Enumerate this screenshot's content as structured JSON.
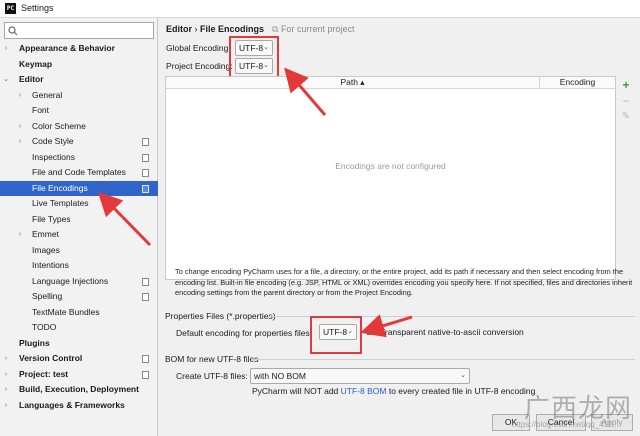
{
  "window": {
    "title": "Settings",
    "app_icon": "pycharm-icon"
  },
  "search": {
    "placeholder": "",
    "icon": "search-icon"
  },
  "sidebar": {
    "items": [
      {
        "label": "Appearance & Behavior",
        "bold": true,
        "expandable": true,
        "level": 0
      },
      {
        "label": "Keymap",
        "bold": true,
        "expandable": false,
        "level": 0
      },
      {
        "label": "Editor",
        "bold": true,
        "expandable": true,
        "expanded": true,
        "level": 0
      },
      {
        "label": "General",
        "expandable": true,
        "level": 1
      },
      {
        "label": "Font",
        "level": 1
      },
      {
        "label": "Color Scheme",
        "expandable": true,
        "level": 1
      },
      {
        "label": "Code Style",
        "expandable": true,
        "level": 1,
        "page_icon": true
      },
      {
        "label": "Inspections",
        "level": 1,
        "page_icon": true
      },
      {
        "label": "File and Code Templates",
        "level": 1,
        "page_icon": true
      },
      {
        "label": "File Encodings",
        "level": 1,
        "page_icon": true,
        "selected": true
      },
      {
        "label": "Live Templates",
        "level": 1
      },
      {
        "label": "File Types",
        "level": 1
      },
      {
        "label": "Emmet",
        "expandable": true,
        "level": 1
      },
      {
        "label": "Images",
        "level": 1
      },
      {
        "label": "Intentions",
        "level": 1
      },
      {
        "label": "Language Injections",
        "level": 1,
        "page_icon": true
      },
      {
        "label": "Spelling",
        "level": 1,
        "page_icon": true
      },
      {
        "label": "TextMate Bundles",
        "level": 1
      },
      {
        "label": "TODO",
        "level": 1
      },
      {
        "label": "Plugins",
        "bold": true,
        "level": 0
      },
      {
        "label": "Version Control",
        "bold": true,
        "expandable": true,
        "level": 0,
        "page_icon": true
      },
      {
        "label": "Project: test",
        "bold": true,
        "expandable": true,
        "level": 0,
        "page_icon": true
      },
      {
        "label": "Build, Execution, Deployment",
        "bold": true,
        "expandable": true,
        "level": 0
      },
      {
        "label": "Languages & Frameworks",
        "bold": true,
        "expandable": true,
        "level": 0
      }
    ]
  },
  "breadcrumb": {
    "section": "Editor",
    "separator": "›",
    "page": "File Encodings",
    "scope_note": "For current project"
  },
  "encoding": {
    "global_label": "Global Encoding:",
    "global_value": "UTF-8",
    "project_label": "Project Encoding:",
    "project_value": "UTF-8"
  },
  "table": {
    "columns": [
      "Path ▴",
      "Encoding"
    ],
    "empty_text": "Encodings are not configured",
    "tools": [
      "add-icon",
      "remove-icon",
      "edit-icon"
    ]
  },
  "description": "To change encoding PyCharm uses for a file, a directory, or the entire project, add its path if necessary and then select encoding from the encoding list. Built-in file encoding (e.g. JSP, HTML or XML) overrides encoding you specify here. If not specified, files and directories inherit encoding settings from the parent directory or from the Project Encoding.",
  "properties": {
    "section_title": "Properties Files (*.properties)",
    "default_label": "Default encoding for properties files:",
    "default_value": "UTF-8",
    "native_checkbox_label": "Transparent native-to-ascii conversion",
    "native_checked": false
  },
  "bom": {
    "section_title": "BOM for new UTF-8 files",
    "create_label": "Create UTF-8 files:",
    "create_value": "with NO BOM",
    "note_prefix": "PyCharm will NOT add",
    "note_link": "UTF-8 BOM",
    "note_suffix": "to every created file in UTF-8 encoding"
  },
  "buttons": {
    "ok": "OK",
    "cancel": "Cancel",
    "apply": "Apply"
  },
  "watermark": {
    "brand": "广西龙网",
    "url": "https://blog.csdn.net/qq_411..."
  },
  "colors": {
    "selection": "#2f65ca",
    "annotation": "#e23a3a",
    "link": "#2a5bd7",
    "add": "#3a9d3a"
  }
}
